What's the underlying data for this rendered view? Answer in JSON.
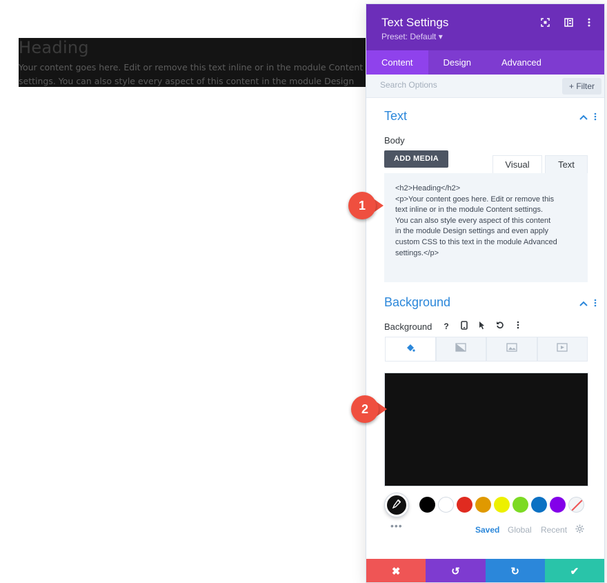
{
  "preview": {
    "heading": "Heading",
    "body": "Your content goes here. Edit or remove this text inline or in the module Content settings. You can also style every aspect of this content in the module Design settings and even apply custom CSS to this text in the module Advanced settings."
  },
  "panel": {
    "title": "Text Settings",
    "preset": "Preset: Default ▾",
    "tabs": [
      "Content",
      "Design",
      "Advanced"
    ],
    "search_placeholder": "Search Options",
    "filter_label": "+ Filter"
  },
  "text_section": {
    "title": "Text",
    "body_label": "Body",
    "add_media": "ADD MEDIA",
    "editor_tabs": [
      "Visual",
      "Text"
    ],
    "code_lines": [
      "<h2>Heading</h2>",
      "<p>Your content goes here. Edit or remove this",
      "text inline or in the module Content settings.",
      "You can also style every aspect of this content",
      "in the module Design settings and even apply",
      "custom CSS to this text in the module Advanced",
      "settings.</p>"
    ]
  },
  "background_section": {
    "title": "Background",
    "label": "Background",
    "color": "#111111",
    "tab_icons": [
      "paint-bucket-icon",
      "gradient-icon",
      "image-icon",
      "video-icon"
    ]
  },
  "palette": {
    "swatches": [
      "#000000",
      "#ffffff",
      "#e02b20",
      "#e09900",
      "#edf000",
      "#7cda24",
      "#0c71c3",
      "#8300e9",
      "none"
    ],
    "tabs": [
      "Saved",
      "Global",
      "Recent"
    ],
    "more": "•••"
  },
  "footer": {
    "buttons": [
      {
        "icon": "close-icon",
        "glyph": "✖",
        "color": "#ef5555"
      },
      {
        "icon": "undo-icon",
        "glyph": "↺",
        "color": "#7e3bd0"
      },
      {
        "icon": "redo-icon",
        "glyph": "↻",
        "color": "#2b87da"
      },
      {
        "icon": "check-icon",
        "glyph": "✔",
        "color": "#29c4a9"
      }
    ]
  },
  "callouts": [
    "1",
    "2"
  ],
  "colors": {
    "header": "#6c2eb9",
    "tabs": "#7e3bd0",
    "active_tab": "#8f42ec",
    "accent": "#2b87da",
    "callout": "#ef4f3f"
  }
}
